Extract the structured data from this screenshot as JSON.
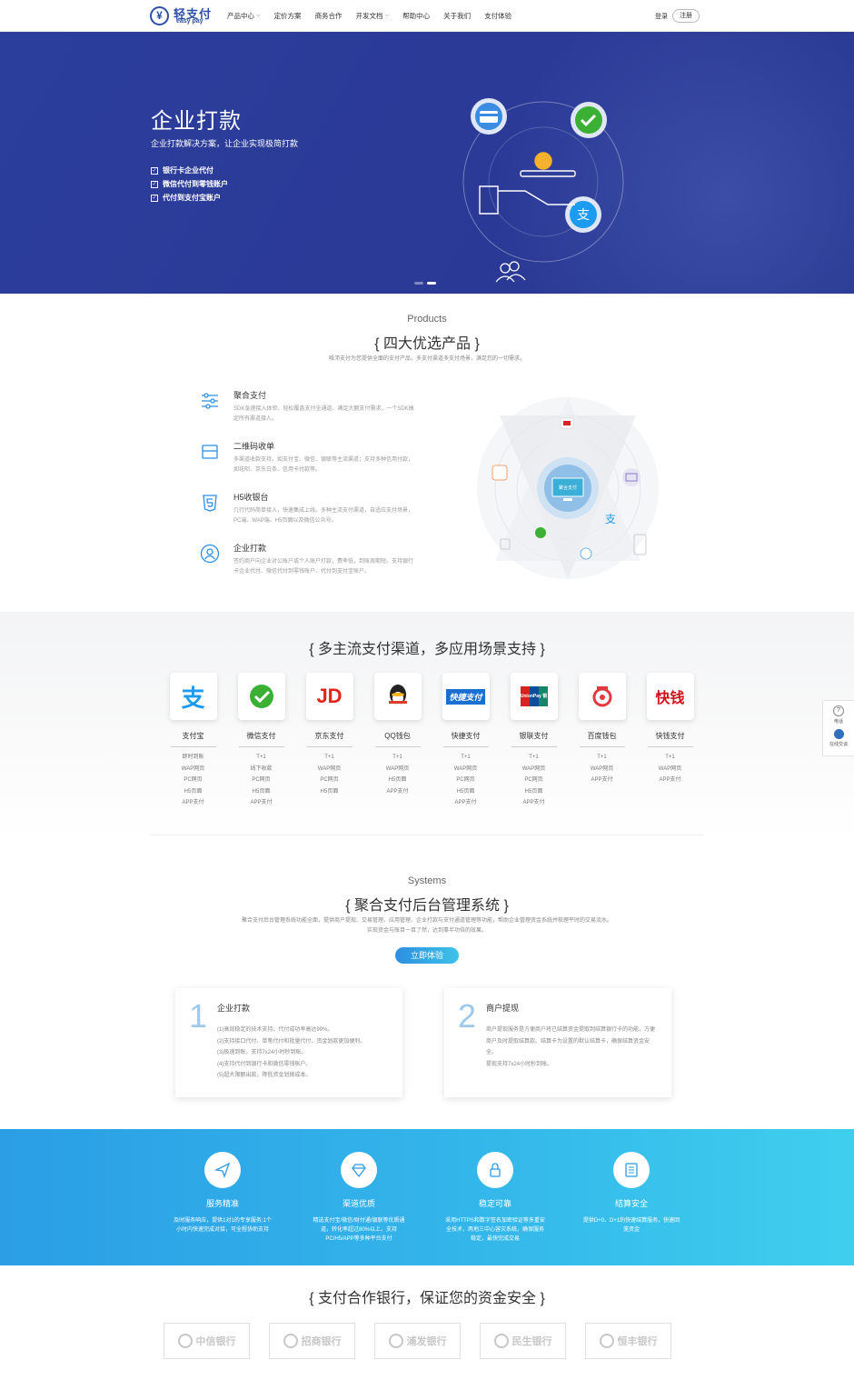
{
  "header": {
    "logo_mark": "¥",
    "logo_cn": "轻支付",
    "logo_en": "easy pay",
    "nav": [
      {
        "label": "产品中心",
        "has_caret": true
      },
      {
        "label": "定价方案",
        "has_caret": false
      },
      {
        "label": "商务合作",
        "has_caret": false
      },
      {
        "label": "开发文档",
        "has_caret": true
      },
      {
        "label": "帮助中心",
        "has_caret": false
      },
      {
        "label": "关于我们",
        "has_caret": false
      },
      {
        "label": "支付体验",
        "has_caret": false
      }
    ],
    "login": "登录",
    "register": "注册"
  },
  "hero": {
    "title": "企业打款",
    "subtitle": "企业打款解决方案，让企业实现极简打款",
    "items": [
      "银行卡企业代付",
      "微信代付到零钱账户",
      "代付到支付宝账户"
    ]
  },
  "products": {
    "en": "Products",
    "title": "{ 四大优选产品 }",
    "desc": "唯沛支付为您提供全面的支付产品，多支付渠道多支付场景，满足您的一切需求。",
    "items": [
      {
        "name": "聚合支付",
        "desc": "SDK急速接入体验，轻松覆盖支付全通道，满足大额支付需求，一个SDK搞定所有渠道接入。",
        "icon": "sliders-icon"
      },
      {
        "name": "二维码收单",
        "desc": "多渠道收款支持，如支付宝、微信、银联等主流渠道；支持多种信用付款，如花呗、京东白条、信用卡付款等。",
        "icon": "card-icon"
      },
      {
        "name": "H5收银台",
        "desc": "几行代码简单接入，快速集成上线。多种主流支付渠道，自适应支付场景，PC端、WAP端、H5页面以及微信公众号。",
        "icon": "html5-icon"
      },
      {
        "name": "企业打款",
        "desc": "签约商户向企业对公账户或个人账户打款，费率低，到账周期短。支持银行卡企业代付、微信代付到零钱账户、代付到支付宝账户。",
        "icon": "user-icon"
      }
    ],
    "center_label": "聚合支付"
  },
  "channels": {
    "title": "{ 多主流支付渠道，多应用场景支持 }",
    "items": [
      {
        "name": "支付宝",
        "features": [
          "即时到账",
          "WAP网页",
          "PC网页",
          "H5页面",
          "APP支付"
        ],
        "logo": "alipay-logo"
      },
      {
        "name": "微信支付",
        "features": [
          "T+1",
          "线下收款",
          "PC网页",
          "H5页面",
          "APP支付"
        ],
        "logo": "wechat-logo"
      },
      {
        "name": "京东支付",
        "features": [
          "T+1",
          "WAP网页",
          "PC网页",
          "H5页面"
        ],
        "logo": "jd-logo"
      },
      {
        "name": "QQ钱包",
        "features": [
          "T+1",
          "WAP网页",
          "H5页面",
          "APP支付"
        ],
        "logo": "qq-logo"
      },
      {
        "name": "快捷支付",
        "features": [
          "T+1",
          "WAP网页",
          "PC网页",
          "H5页面",
          "APP支付"
        ],
        "logo": "quickpay-logo"
      },
      {
        "name": "银联支付",
        "features": [
          "T+1",
          "WAP网页",
          "PC网页",
          "H5页面",
          "APP支付"
        ],
        "logo": "unionpay-logo"
      },
      {
        "name": "百度钱包",
        "features": [
          "T+1",
          "WAP网页",
          "APP支付"
        ],
        "logo": "baidu-wallet-logo"
      },
      {
        "name": "快钱支付",
        "features": [
          "T+1",
          "WAP网页",
          "APP支付"
        ],
        "logo": "99bill-logo"
      }
    ],
    "logo_text": {
      "jd": "JD",
      "quick": "快捷支付",
      "union": "UnionPay 银联",
      "bill": "快钱"
    }
  },
  "side_widget": {
    "phone": "电话",
    "service": "在线交谈"
  },
  "systems": {
    "en": "Systems",
    "title": "{ 聚合支付后台管理系统 }",
    "desc1": "聚合支付后台管理系统功能全面，提供商户提现、交易管理、应用管理、企业打款与支付通道管理等功能，帮助企业管理资金系统并梳理平时的交易流水。",
    "desc2": "实现资金与账目一目了然，达到事半功倍的效果。",
    "button": "立即体验",
    "cards": [
      {
        "num": "1",
        "title": "企业打款",
        "lines": [
          "(1)高效稳定的技术支持，代付成功率高达99%。",
          "(2)支持接口代付、单笔代付和批量代付，资金划款更加便利。",
          "(3)极速到账，支持7x24小时秒到账。",
          "(4)支持代付到银行卡和微信零钱账户。",
          "(5)超大限额出款，降低资金划拨成本。"
        ]
      },
      {
        "num": "2",
        "title": "商户提现",
        "lines": [
          "商户提现服务是方便商户将已结算资金提取到结算银行卡的功能，方便商户及时提取结算款。结算卡为设置的默认结算卡，确保结算资金安全。",
          "提现支持7x24小时秒到账。"
        ]
      }
    ]
  },
  "features": [
    {
      "title": "服务精准",
      "desc": "及时服务响应，提供1对1的专享服务;1个小时内快速完成对接，可全程协助支持",
      "icon": "paper-plane-icon"
    },
    {
      "title": "渠道优质",
      "desc": "精选支付宝/微信/财付通/银联等优质通道，转化率超过80%以上，支持PC/H5/APP等多种平台支付",
      "icon": "diamond-icon"
    },
    {
      "title": "稳定可靠",
      "desc": "采用HTTPS和数字签名加密验证等多重安全技术，两地三中心容灾系统，确保服务稳定，最快完成交易",
      "icon": "lock-icon"
    },
    {
      "title": "结算安全",
      "desc": "提供D+0、D+1的快速结算服务，快速回笼资金",
      "icon": "ledger-icon"
    }
  ],
  "banks": {
    "title": "{ 支付合作银行，保证您的资金安全 }",
    "items": [
      "中信银行",
      "招商银行",
      "浦发银行",
      "民生银行",
      "恒丰银行"
    ]
  },
  "colors": {
    "primary": "#2b3e9c",
    "accent": "#2e8fe6",
    "band_start": "#2b9ee5",
    "band_end": "#3fcfee"
  }
}
